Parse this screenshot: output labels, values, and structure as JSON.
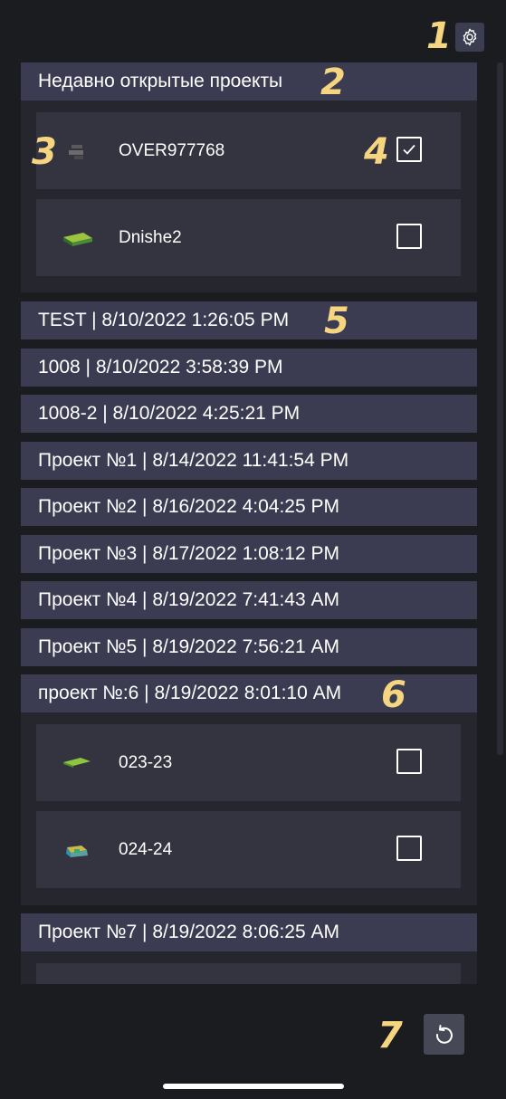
{
  "markers": [
    "1",
    "2",
    "3",
    "4",
    "5",
    "6",
    "7"
  ],
  "recent": {
    "title": "Недавно открытые проекты",
    "items": [
      {
        "name": "OVER977768",
        "checked": true,
        "icon": "dark-model-thumbnail"
      },
      {
        "name": "Dnishe2",
        "checked": false,
        "icon": "green-block-thumbnail"
      }
    ]
  },
  "projects": [
    {
      "title": "TEST | 8/10/2022 1:26:05 PM"
    },
    {
      "title": "1008 | 8/10/2022 3:58:39 PM"
    },
    {
      "title": "1008-2 | 8/10/2022 4:25:21 PM"
    },
    {
      "title": "Проект №1 | 8/14/2022 11:41:54 PM"
    },
    {
      "title": "Проект №2 | 8/16/2022 4:04:25 PM"
    },
    {
      "title": "Проект №3 | 8/17/2022 1:08:12 PM"
    },
    {
      "title": "Проект №4 | 8/19/2022 7:41:43 AM"
    },
    {
      "title": "Проект №5 | 8/19/2022 7:56:21 AM"
    },
    {
      "title": "проект №:6 | 8/19/2022 8:01:10 AM",
      "items": [
        {
          "name": "023-23",
          "checked": false,
          "icon": "green-plate-thumbnail"
        },
        {
          "name": "024-24",
          "checked": false,
          "icon": "mixed-model-thumbnail"
        }
      ]
    },
    {
      "title": "Проект №7 | 8/19/2022 8:06:25 AM"
    }
  ],
  "icons": {
    "settings": "gear-icon",
    "reset": "reset-icon",
    "check": "checkmark-icon"
  },
  "colors": {
    "background": "#1b1c20",
    "header": "#3b3c52",
    "panel": "#25262e",
    "item": "#33343f",
    "marker": "#f5d580"
  }
}
